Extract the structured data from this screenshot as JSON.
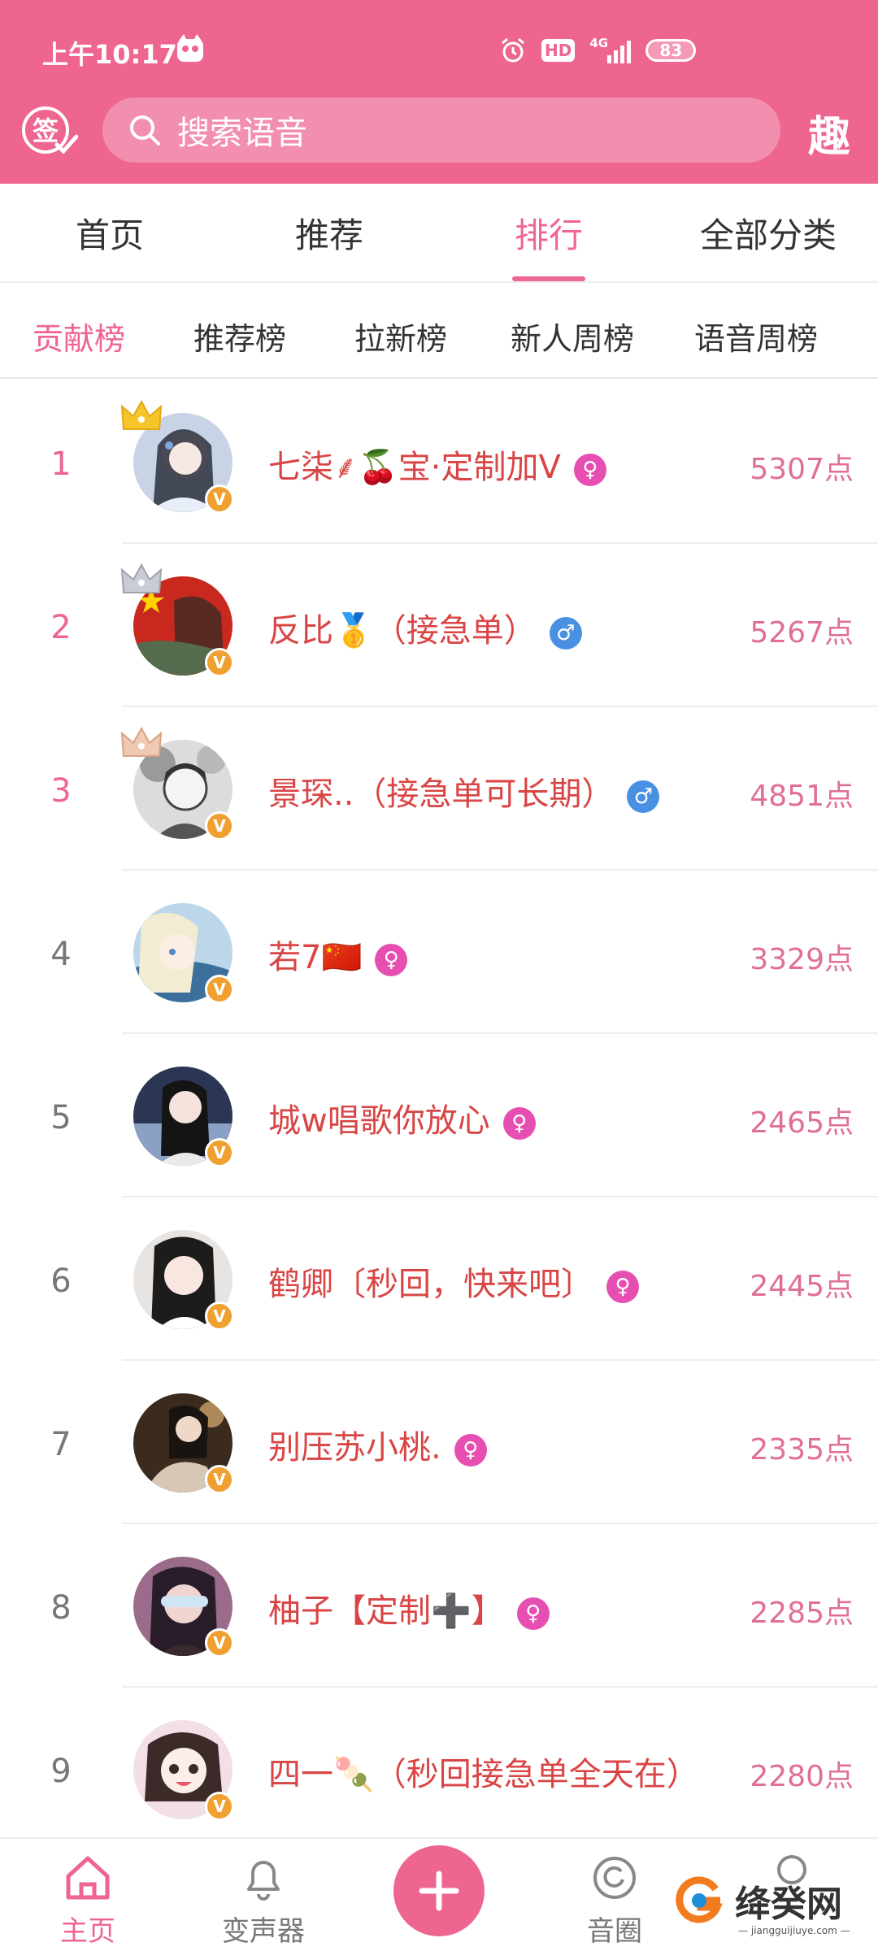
{
  "status_bar": {
    "time": "上午10:17",
    "hd_label": "HD",
    "network_label": "4G",
    "battery": "83"
  },
  "header": {
    "sign_label": "签",
    "search_placeholder": "搜索语音",
    "fun_label": "趣"
  },
  "tabs": [
    {
      "label": "首页",
      "active": false
    },
    {
      "label": "推荐",
      "active": false
    },
    {
      "label": "排行",
      "active": true
    },
    {
      "label": "全部分类",
      "active": false
    }
  ],
  "sub_tabs": [
    {
      "label": "贡献榜",
      "active": true
    },
    {
      "label": "推荐榜",
      "active": false
    },
    {
      "label": "拉新榜",
      "active": false
    },
    {
      "label": "新人周榜",
      "active": false
    },
    {
      "label": "语音周榜",
      "active": false
    }
  ],
  "ranking": [
    {
      "rank": "1",
      "name": "七柒⸙🍒宝·定制加V",
      "gender": "female",
      "points": "5307点",
      "crown": "gold"
    },
    {
      "rank": "2",
      "name": "反比🥇（接急单）",
      "gender": "male",
      "points": "5267点",
      "crown": "silver"
    },
    {
      "rank": "3",
      "name": "景琛..（接急单可长期）",
      "gender": "male",
      "points": "4851点",
      "crown": "bronze"
    },
    {
      "rank": "4",
      "name": "若7🇨🇳",
      "gender": "female",
      "points": "3329点",
      "crown": ""
    },
    {
      "rank": "5",
      "name": "城w唱歌你放心",
      "gender": "female",
      "points": "2465点",
      "crown": ""
    },
    {
      "rank": "6",
      "name": "鹤卿〔秒回，快来吧〕",
      "gender": "female",
      "points": "2445点",
      "crown": ""
    },
    {
      "rank": "7",
      "name": "别压苏小桃.",
      "gender": "female",
      "points": "2335点",
      "crown": ""
    },
    {
      "rank": "8",
      "name": "柚子【定制➕】",
      "gender": "female",
      "points": "2285点",
      "crown": ""
    },
    {
      "rank": "9",
      "name": "四一🍡（秒回接急单全天在）",
      "gender": "female",
      "points": "2280点",
      "crown": ""
    }
  ],
  "badges": {
    "verified": "V",
    "female_symbol": "♀",
    "male_symbol": "♂"
  },
  "bottom_nav": [
    {
      "label": "主页",
      "icon": "home-icon",
      "active": true
    },
    {
      "label": "变声器",
      "icon": "bell-icon",
      "active": false
    },
    {
      "label": "",
      "icon": "plus-icon",
      "active": false
    },
    {
      "label": "音圈",
      "icon": "circle-icon",
      "active": false
    }
  ],
  "watermark": {
    "text": "绛癸网",
    "sub": "— jiangguijiuye.com —"
  },
  "colors": {
    "brand": "#ee6590",
    "name": "#d94545",
    "points": "#e06f93",
    "female": "#e64fb1",
    "male": "#4a90e2",
    "verified": "#f0a030"
  }
}
